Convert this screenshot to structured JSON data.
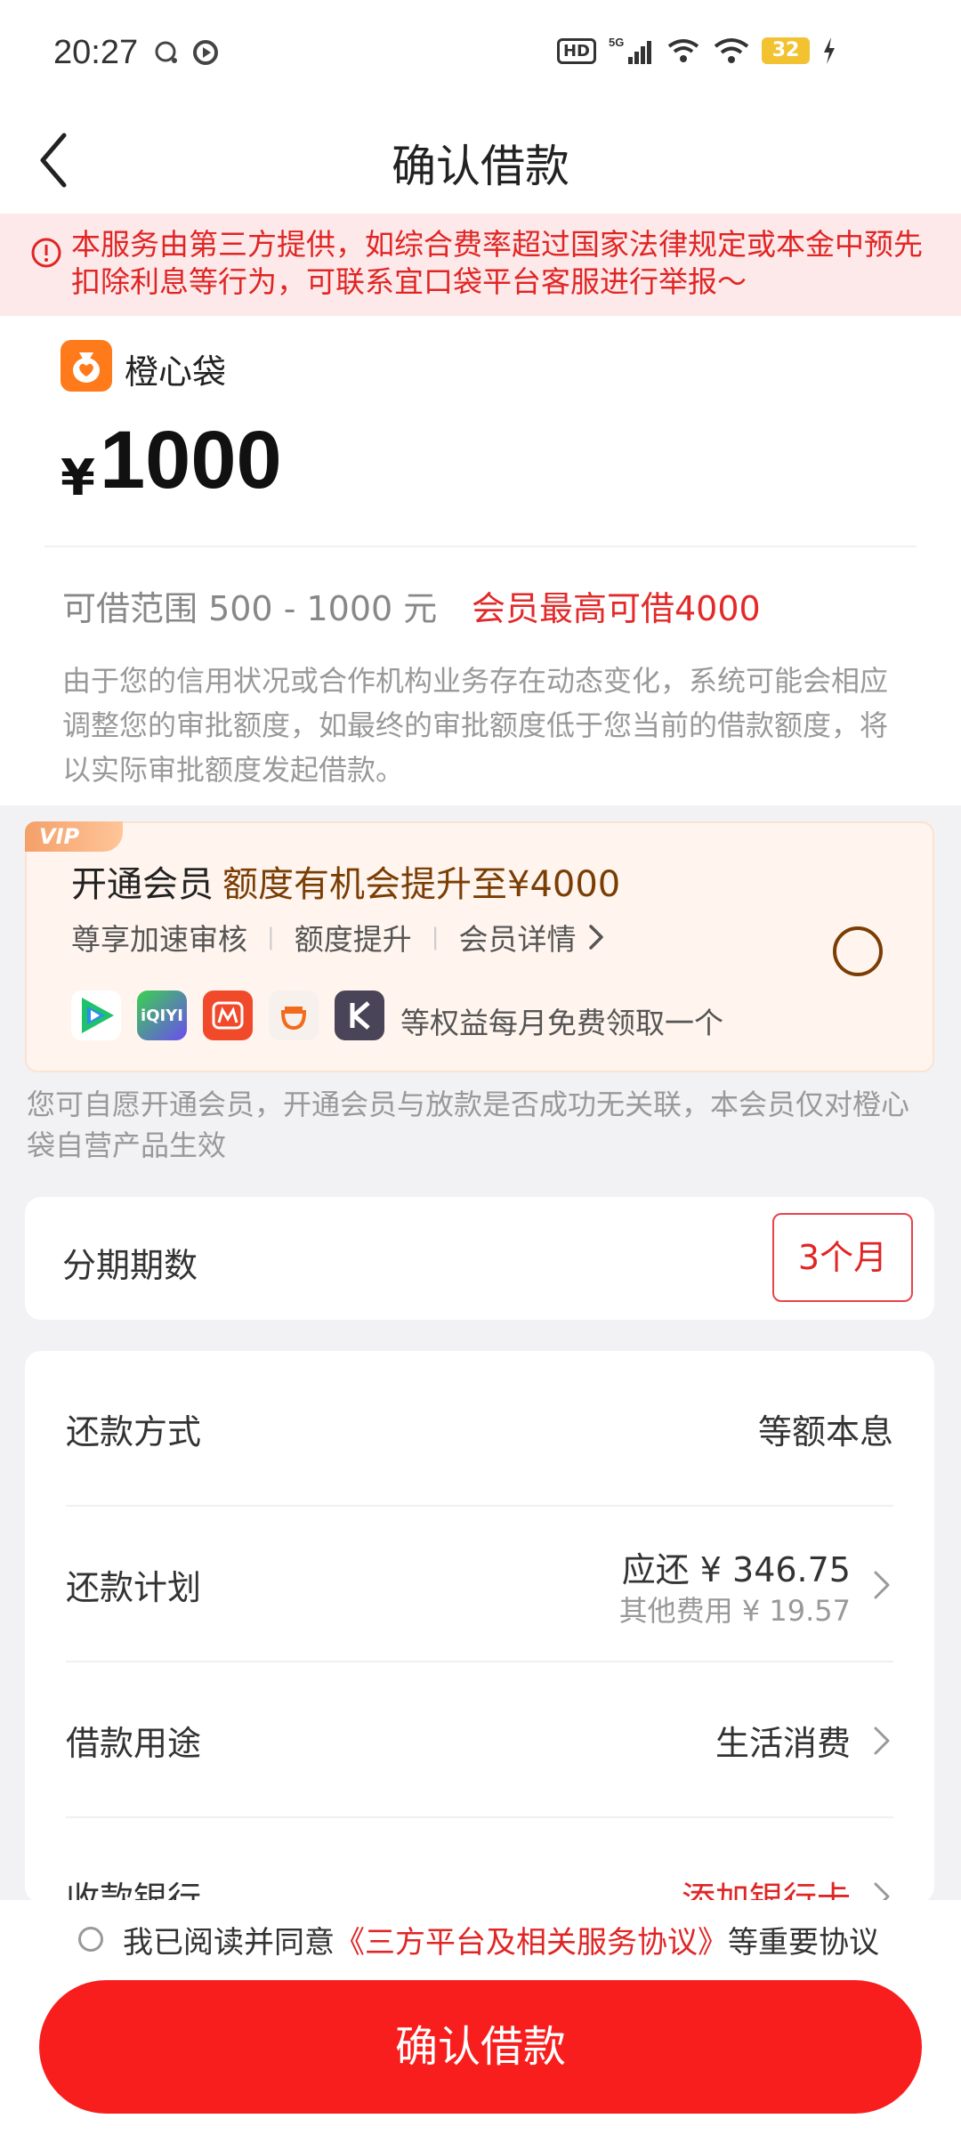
{
  "status": {
    "time": "20:27",
    "hd": "HD",
    "network": "5G",
    "battery": "32"
  },
  "nav": {
    "title": "确认借款"
  },
  "notice": {
    "text": "本服务由第三方提供，如综合费率超过国家法律规定或本金中预先扣除利息等行为，可联系宜口袋平台客服进行举报～"
  },
  "loan": {
    "brand": "橙心袋",
    "currency": "¥",
    "amount": "1000",
    "range": "可借范围 500 - 1000 元",
    "vip_max": "会员最高可借4000",
    "description": "由于您的信用状况或合作机构业务存在动态变化，系统可能会相应调整您的审批额度，如最终的审批额度低于您当前的借款额度，将以实际审批额度发起借款。"
  },
  "vip": {
    "tag": "VIP",
    "title": "开通会员",
    "subtitle": "额度有机会提升至¥4000",
    "perks": [
      "尊享加速审核",
      "额度提升",
      "会员详情"
    ],
    "partners": [
      "腾讯视频",
      "iQIYI",
      "芒果TV",
      "滴滴",
      "Keep"
    ],
    "benefit": "等权益每月免费领取一个",
    "note": "您可自愿开通会员，开通会员与放款是否成功无关联，本会员仅对橙心袋自营产品生效"
  },
  "term": {
    "label": "分期期数",
    "value": "3个月"
  },
  "details": {
    "method_label": "还款方式",
    "method_value": "等额本息",
    "plan_label": "还款计划",
    "plan_main": "应还 ¥ 346.75",
    "plan_sub": "其他费用 ¥ 19.57",
    "purpose_label": "借款用途",
    "purpose_value": "生活消费",
    "bank_label": "收款银行",
    "bank_value": "添加银行卡"
  },
  "agreement": {
    "prefix": "我已阅读并同意",
    "link": "《三方平台及相关服务协议》",
    "suffix": "等重要协议"
  },
  "confirm_button": "确认借款",
  "colors": {
    "accent_red": "#f91e1e",
    "notice_bg": "#fde9e9",
    "vip_brown": "#7a3e05"
  }
}
